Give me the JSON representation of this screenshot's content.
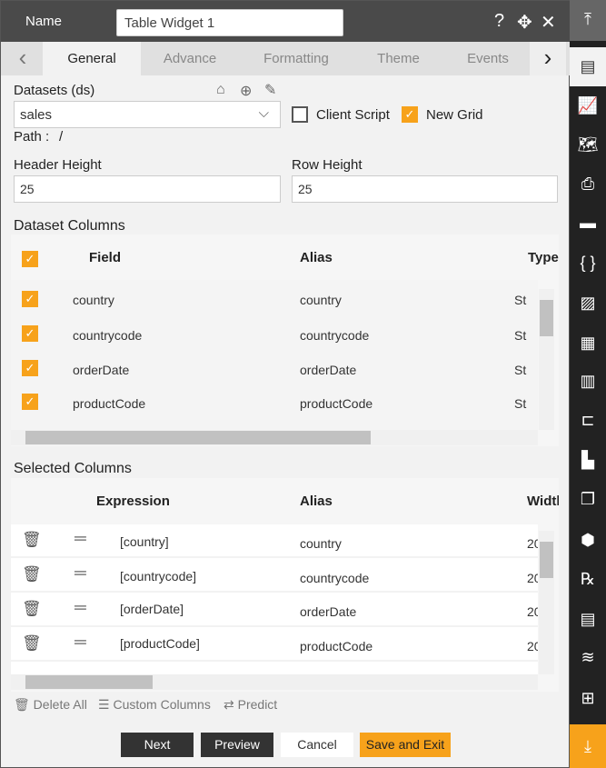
{
  "header": {
    "name_label": "Name",
    "name_value": "Table Widget 1",
    "icons": [
      "help-icon",
      "move-icon",
      "close-icon"
    ]
  },
  "tabs": [
    "General",
    "Advance",
    "Formatting",
    "Theme",
    "Events"
  ],
  "datasets": {
    "label": "Datasets (ds)",
    "value": "sales",
    "client_script": "Client Script",
    "client_script_checked": false,
    "new_grid": "New Grid",
    "new_grid_checked": true,
    "path_label": "Path :",
    "path_value": "/"
  },
  "header_height": {
    "label": "Header Height",
    "value": "25"
  },
  "row_height": {
    "label": "Row Height",
    "value": "25"
  },
  "dataset_columns": {
    "title": "Dataset Columns",
    "headers": [
      "Field",
      "Alias",
      "Type"
    ],
    "rows": [
      {
        "field": "country",
        "alias": "country",
        "type": "St"
      },
      {
        "field": "countrycode",
        "alias": "countrycode",
        "type": "St"
      },
      {
        "field": "orderDate",
        "alias": "orderDate",
        "type": "St"
      },
      {
        "field": "productCode",
        "alias": "productCode",
        "type": "St"
      }
    ]
  },
  "selected_columns": {
    "title": "Selected Columns",
    "headers": [
      "Expression",
      "Alias",
      "Width"
    ],
    "rows": [
      {
        "expr": "[country]",
        "alias": "country",
        "width": "20"
      },
      {
        "expr": "[countrycode]",
        "alias": "countrycode",
        "width": "20"
      },
      {
        "expr": "[orderDate]",
        "alias": "orderDate",
        "width": "20"
      },
      {
        "expr": "[productCode]",
        "alias": "productCode",
        "width": "20"
      }
    ]
  },
  "tools": {
    "delete_all": "Delete All",
    "custom_columns": "Custom Columns",
    "predict": "Predict"
  },
  "buttons": {
    "next": "Next",
    "preview": "Preview",
    "cancel": "Cancel",
    "save_exit": "Save and Exit"
  },
  "colors": {
    "accent": "#f7a21b",
    "header": "#4a4a4a",
    "sidebar": "#222222"
  }
}
